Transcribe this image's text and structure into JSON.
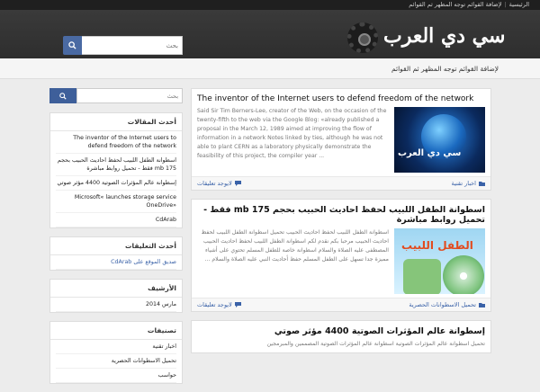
{
  "topnav": {
    "home": "الرئيسية",
    "add": "لإضافة القوائم توجه المظهر ثم القوائم"
  },
  "logo": {
    "text": "سي دي العرب"
  },
  "search_top": {
    "placeholder": "بحث"
  },
  "navbar": {
    "menu_notice": "لإضافة القوائم توجه المظهر ثم القوائم"
  },
  "sidebar": {
    "search_placeholder": "بحث",
    "recent_posts": {
      "title": "أحدث المقالات",
      "items": [
        "The inventor of the Internet users to defend freedom of the network",
        "اسطوانة الطفل اللبيب لحفظ احاديث الحبيب  بحجم 175 mb فقط - تحميل روابط مباشرة",
        "إسطوانة عالم المؤثرات الصوتية 4400 مؤثر صوتي",
        "Microsoft« launches storage service OneDrive»",
        "CdArab"
      ]
    },
    "recent_comments": {
      "title": "أحدث التعليقات",
      "items": [
        "صديق الموقع على CdArab"
      ]
    },
    "archive": {
      "title": "الأرشيف",
      "items": [
        "مارس 2014"
      ]
    },
    "categories": {
      "title": "تصنيفات",
      "items": [
        "اخبار تقنية",
        "تحميل الاسطوانات الحصرية",
        "حواسب"
      ]
    }
  },
  "posts": [
    {
      "title": "The inventor of the Internet users to defend freedom of the network",
      "excerpt": "Said Sir Tim Berners-Lee, creator of the Web, on the occasion of the twenty-fifth to the web via the Google Blog: «already published a proposal in the March 12, 1989 aimed at improving the flow of information in a network Notes linked by ties, although he was not able to plant CERN as a laboratory physically demonstrate the feasibility of this project, the compiler year ...",
      "thumb_label": "سي دي العرب",
      "category": "اخبار تقنية",
      "comments": "لايوجد تعليقات"
    },
    {
      "title": "اسطوانة الطفل اللبيب لحفظ احاديث الحبيب  بحجم 175 mb فقط - تحميل روابط مباشرة",
      "excerpt": "اسطوانة الطفل اللبيب لحفظ احاديث الحبيب تحميل اسطوانة الطفل اللبيب لحفظ احاديث الحبيب مرحبا بكم نقدم لكم اسطوانة الطفل اللبيب لحفظ احاديث الحبيب المصطفى عليه الصلاة والسلام اسطوانة خاصة للطفل المسلم تحتوي على أشياء مميزة جدا تسهل على الطفل المسلم حفظ أحاديث النبي عليه الصلاة والسلام ...",
      "thumb_label": "الطفل اللبيب",
      "category": "تحميل الاسطوانات الحصرية",
      "comments": "لايوجد تعليقات"
    },
    {
      "title": "إسطوانة عالم المؤثرات الصوتية 4400 مؤثر صوتي",
      "excerpt": "تحميل اسطوانة عالم المؤثرات الصوتية اسطوانة عالم المؤثرات الصوتية المصممين والمبرمجين"
    }
  ],
  "colors": {
    "accent": "#3a62a8",
    "button": "#4a6aa3",
    "header": "#333333"
  }
}
